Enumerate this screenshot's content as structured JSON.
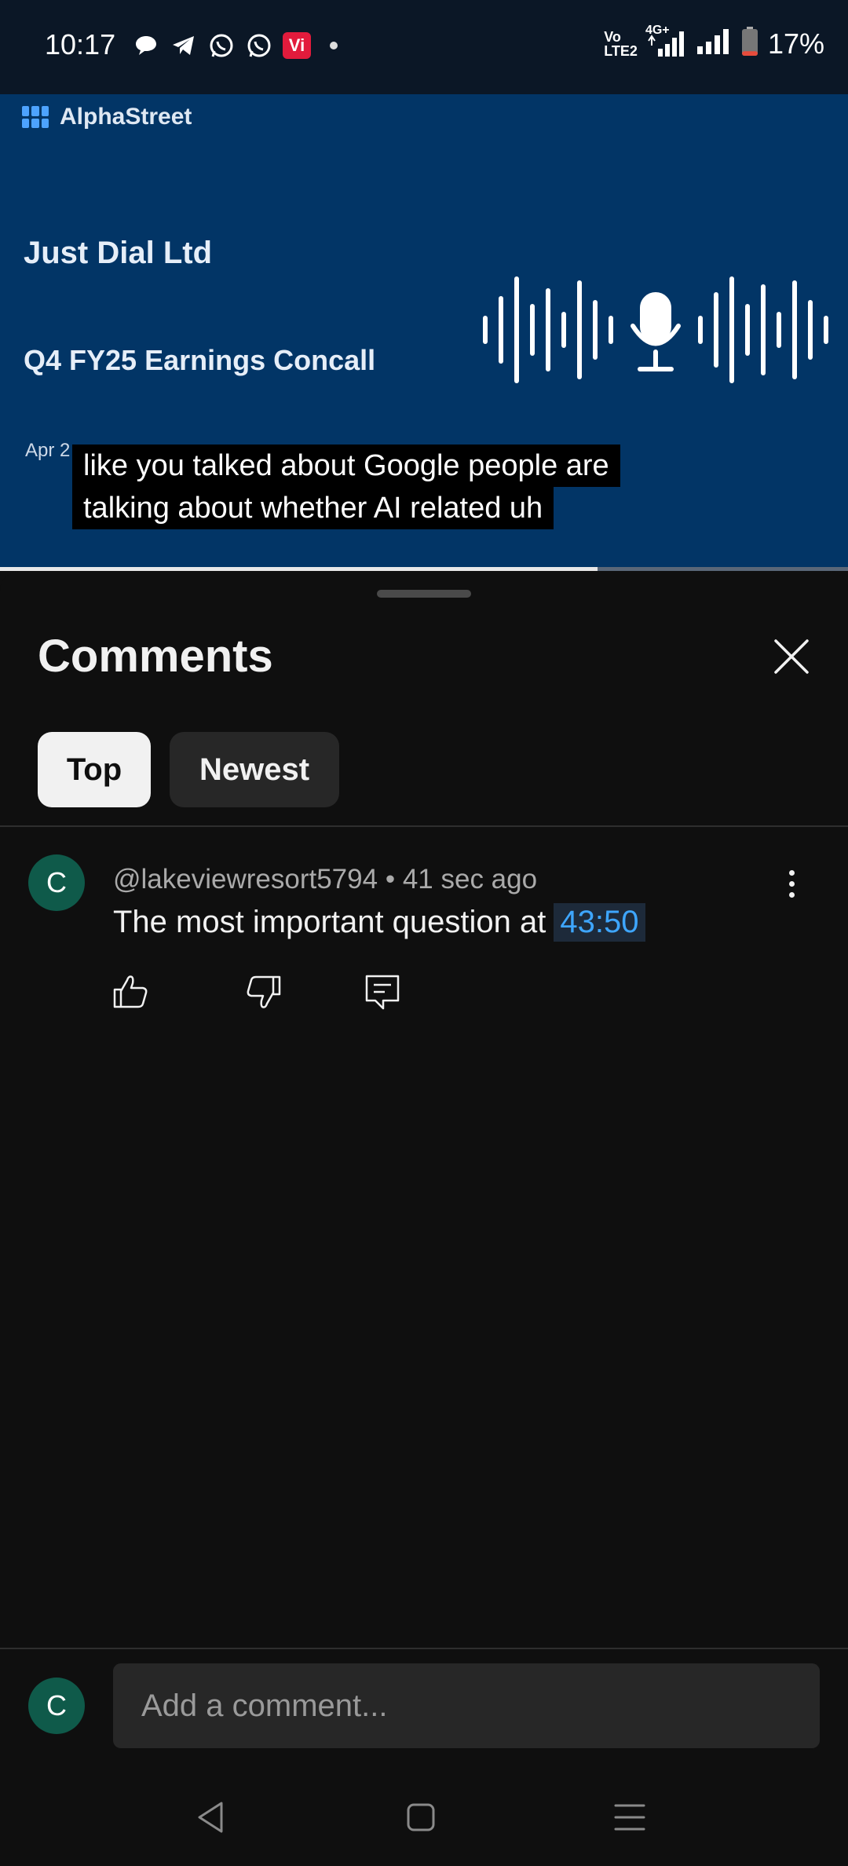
{
  "status_bar": {
    "time": "10:17",
    "notification_icons": [
      "chat-bubble-icon",
      "telegram-icon",
      "whatsapp-icon",
      "whatsapp-icon",
      "vi-app-icon"
    ],
    "vi_label": "Vi",
    "network_label_top": "Vo",
    "network_label_bottom": "LTE2",
    "data_label": "4G+",
    "battery_percent": "17%",
    "battery_level": 0.17
  },
  "video": {
    "brand": "AlphaStreet",
    "company": "Just Dial Ltd",
    "event": "Q4 FY25 Earnings Concall",
    "date_visible": "Apr 2",
    "caption_line1": "like you talked about Google people are",
    "caption_line2": "talking about whether AI related uh",
    "progress_fraction": 0.705
  },
  "comments_panel": {
    "title": "Comments",
    "filters": [
      {
        "label": "Top",
        "selected": true
      },
      {
        "label": "Newest",
        "selected": false
      }
    ],
    "comments": [
      {
        "avatar_letter": "C",
        "author": "@lakeviewresort5794",
        "separator": "•",
        "time": "41 sec ago",
        "text": "The most important question at",
        "timestamp_link": "43:50"
      }
    ],
    "add_comment": {
      "avatar_letter": "C",
      "placeholder": "Add a comment..."
    }
  },
  "colors": {
    "background": "#0f0f0f",
    "video_bg": "#023566",
    "avatar": "#0f5a4a",
    "link": "#3ea6ff",
    "chip_selected": "#f1f1f1",
    "chip_unselected": "#272727"
  }
}
